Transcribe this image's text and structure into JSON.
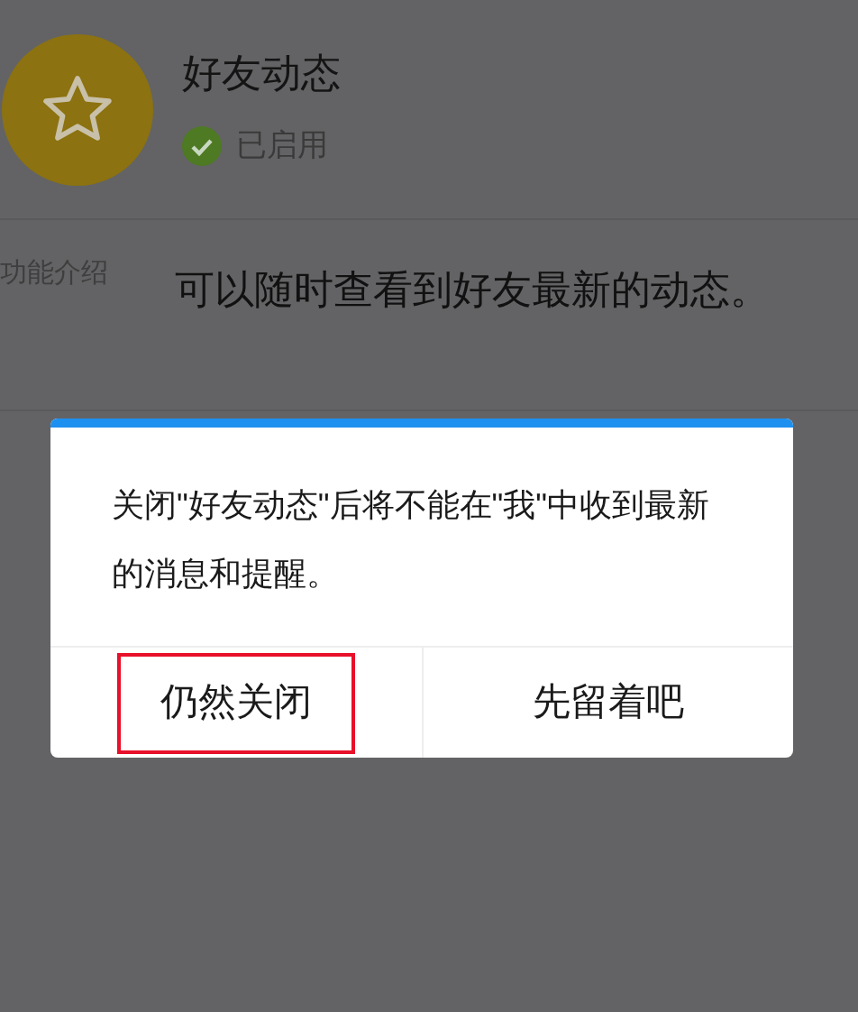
{
  "feature": {
    "title": "好友动态",
    "status": {
      "label": "已启用",
      "enabled": true
    }
  },
  "intro": {
    "label": "功能介绍",
    "text": "可以随时查看到好友最新的动态。"
  },
  "dialog": {
    "message": "关闭\"好友动态\"后将不能在\"我\"中收到最新的消息和提醒。",
    "buttons": [
      {
        "label": "仍然关闭",
        "highlighted": true
      },
      {
        "label": "先留着吧",
        "highlighted": false
      }
    ]
  }
}
